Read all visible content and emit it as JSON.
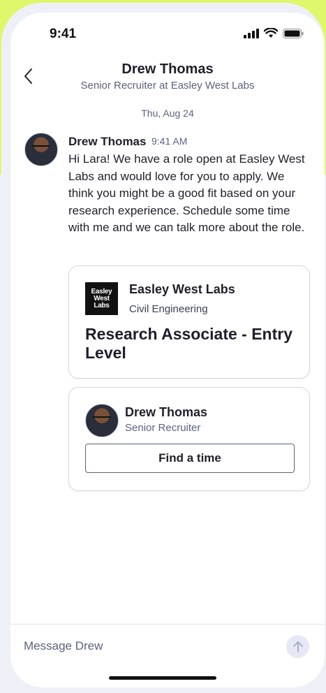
{
  "status_bar": {
    "time": "9:41"
  },
  "header": {
    "name": "Drew Thomas",
    "subtitle": "Senior Recruiter at Easley West Labs"
  },
  "date_separator": "Thu, Aug 24",
  "message": {
    "sender": "Drew Thomas",
    "time": "9:41 AM",
    "body": "Hi Lara! We have a role open at Easley West Labs and would love for you to apply. We think you might be a good fit based on your research experience. Schedule some time with me and we can talk more about the role."
  },
  "job_card": {
    "logo_text": "Easley West Labs",
    "company": "Easley West Labs",
    "department": "Civil Engineering",
    "role": "Research Associate - Entry Level"
  },
  "recruiter_card": {
    "name": "Drew Thomas",
    "title": "Senior Recruiter",
    "button_label": "Find a time"
  },
  "composer": {
    "placeholder": "Message Drew"
  },
  "colors": {
    "accent_bg": "#dff76a",
    "text_primary": "#1f1f2b",
    "text_secondary": "#5c6280",
    "send_button_bg": "#e6e9f5"
  },
  "icons": [
    "back-chevron-icon",
    "cellular-signal-icon",
    "wifi-icon",
    "battery-icon",
    "send-arrow-icon"
  ]
}
